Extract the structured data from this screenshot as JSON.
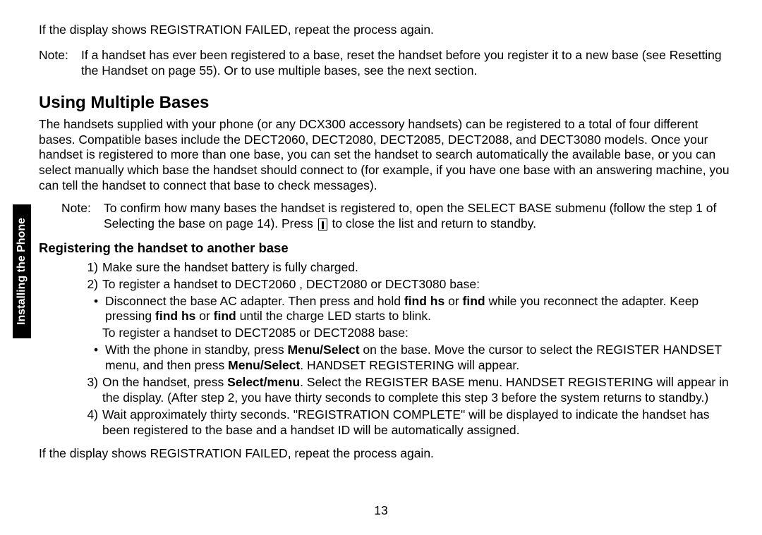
{
  "sidebar": {
    "label": "Installing the Phone"
  },
  "intro": "If the display shows REGISTRATION FAILED, repeat the process again.",
  "note1": {
    "label": "Note:",
    "text": "If a handset has ever been registered to a base, reset the handset before you register it to a new base (see Resetting the Handset on page 55). Or to use multiple bases, see the next section."
  },
  "section": {
    "title": "Using Multiple Bases",
    "body": "The handsets supplied with your phone (or any DCX300 accessory handsets) can be registered to a total of four different bases. Compatible bases include the DECT2060, DECT2080, DECT2085, DECT2088, and DECT3080 models. Once your handset is registered to more than one base, you can set the handset to search automatically the available base, or you can select manually which base the handset should connect to (for example, if you have one base with an answering machine, you can tell the handset to connect that base to check messages)."
  },
  "note2": {
    "label": "Note:",
    "text_a": "To confirm how many bases the handset is registered to, open the SELECT BASE submenu (follow the step 1 of Selecting the base on page 14). Press ",
    "text_b": " to close the list and return to standby."
  },
  "sub": {
    "title": "Registering the handset to another base",
    "steps": {
      "s1": {
        "num": "1)",
        "text": "Make sure the handset battery is fully charged."
      },
      "s2": {
        "num": "2)",
        "text": "To register a handset to DECT2060 , DECT2080 or DECT3080 base:"
      },
      "b1_a": "Disconnect the base AC adapter. Then press and hold ",
      "b1_b": "find hs",
      "b1_c": " or ",
      "b1_d": "find",
      "b1_e": " while you reconnect the adapter. Keep pressing ",
      "b1_f": "find hs",
      "b1_g": " or ",
      "b1_h": "find",
      "b1_i": " until the charge LED starts to blink.",
      "alt": "To register a handset to DECT2085 or DECT2088 base:",
      "b2_a": "With the phone in standby, press ",
      "b2_b": "Menu/Select",
      "b2_c": " on the base. Move the cursor to select the REGISTER HANDSET menu, and then press ",
      "b2_d": "Menu/Select",
      "b2_e": ". HANDSET REGISTERING will appear.",
      "s3": {
        "num": "3)",
        "a": "On the handset, press ",
        "b": "Select/menu",
        "c": ". Select the REGISTER BASE menu. HANDSET REGISTERING will appear in the display. (After step 2, you have thirty seconds to complete this step 3 before the system returns to standby.)"
      },
      "s4": {
        "num": "4)",
        "text": "Wait approximately thirty seconds. \"REGISTRATION COMPLETE\" will be displayed to indicate the handset has been registered to the base and a handset ID will be automatically assigned."
      }
    },
    "closing": "If the display shows REGISTRATION FAILED, repeat the process again."
  },
  "page": "13"
}
